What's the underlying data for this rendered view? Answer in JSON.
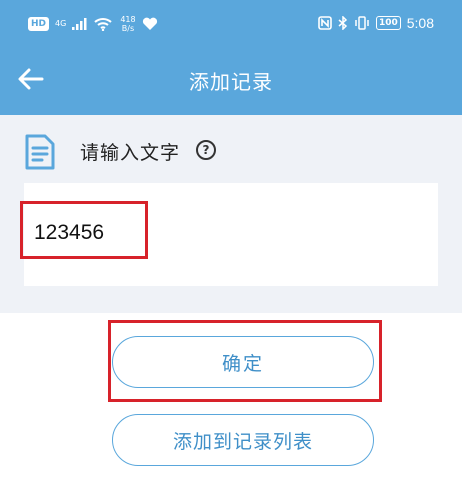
{
  "status_bar": {
    "hd_badge": "HD",
    "signal_label": "4G",
    "net_speed_value": "418",
    "net_speed_unit": "B/s",
    "battery": "100",
    "time": "5:08"
  },
  "app_bar": {
    "title": "添加记录"
  },
  "content": {
    "prompt": "请输入文字",
    "help_symbol": "?",
    "input_value": "123456"
  },
  "buttons": {
    "confirm": "确定",
    "add_to_list": "添加到记录列表"
  },
  "colors": {
    "accent": "#5aa7dc",
    "panel_bg": "#eff2f7",
    "highlight": "#d7222a"
  }
}
